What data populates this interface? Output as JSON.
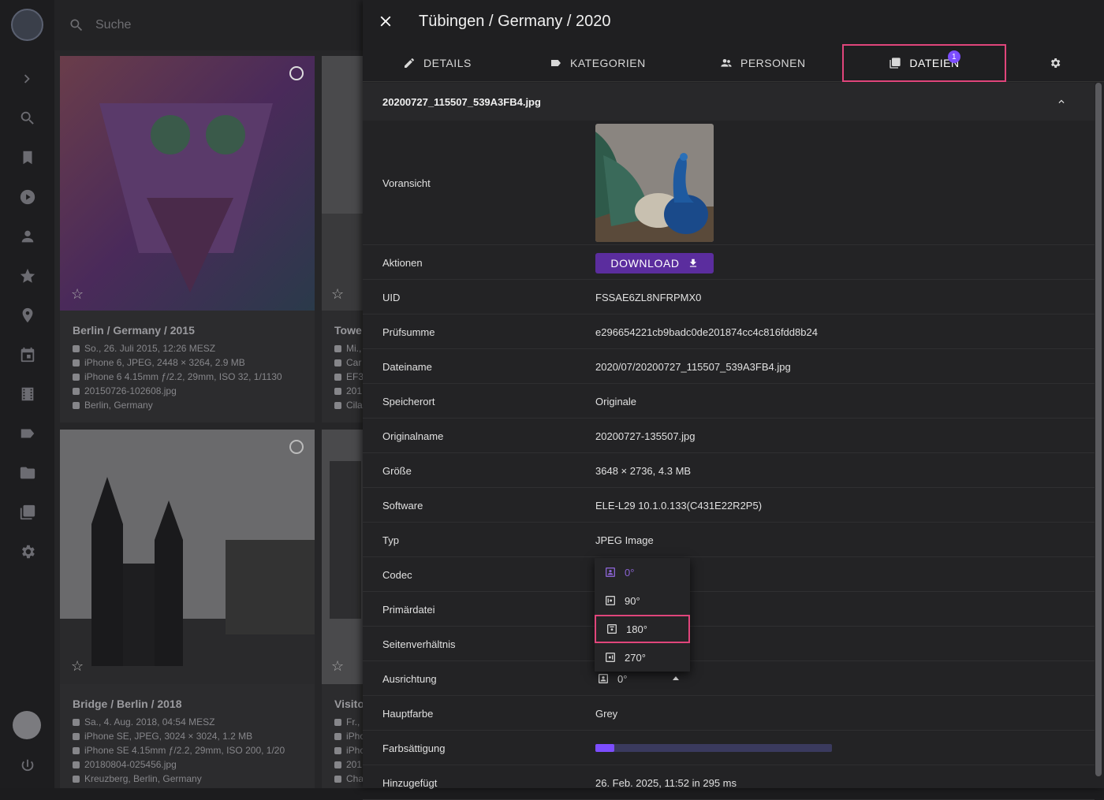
{
  "search": {
    "placeholder": "Suche"
  },
  "nav": {
    "items": [
      "expand-icon",
      "search-icon",
      "bookmark-icon",
      "play-icon",
      "person-icon",
      "star-icon",
      "location-icon",
      "calendar-icon",
      "film-icon",
      "tag-icon",
      "folder-icon",
      "files-icon",
      "gear-icon"
    ],
    "power": "power-icon"
  },
  "cards": [
    {
      "title": "Berlin / Germany / 2015",
      "lines": [
        "So., 26. Juli 2015, 12:26 MESZ",
        "iPhone 6, JPEG, 2448 × 3264, 2.9 MB",
        "iPhone 6 4.15mm ƒ/2.2, 29mm, ISO 32, 1/1130",
        "20150726-102608.jpg",
        "Berlin, Germany"
      ]
    },
    {
      "title": "Towe",
      "lines": [
        "Mi.,",
        "Car",
        "EF3",
        "201",
        "Cila"
      ]
    },
    {
      "title": "Bridge / Berlin / 2018",
      "lines": [
        "Sa., 4. Aug. 2018, 04:54 MESZ",
        "iPhone SE, JPEG, 3024 × 3024, 1.2 MB",
        "iPhone SE 4.15mm ƒ/2.2, 29mm, ISO 200, 1/20",
        "20180804-025456.jpg",
        "Kreuzberg, Berlin, Germany"
      ]
    },
    {
      "title": "Visito",
      "lines": [
        "Fr.,",
        "iPho",
        "iPho",
        "201",
        "Cha"
      ]
    }
  ],
  "panel": {
    "title": "Tübingen / Germany / 2020",
    "tabs": [
      {
        "label": "DETAILS",
        "icon": "pencil-icon"
      },
      {
        "label": "KATEGORIEN",
        "icon": "label-icon"
      },
      {
        "label": "PERSONEN",
        "icon": "people-icon"
      },
      {
        "label": "DATEIEN",
        "icon": "files-icon",
        "badge": "1"
      }
    ],
    "file": {
      "name": "20200727_115507_539A3FB4.jpg"
    },
    "labels": {
      "preview": "Voransicht",
      "actions": "Aktionen",
      "download": "DOWNLOAD"
    },
    "rows": [
      {
        "label": "UID",
        "value": "FSSAE6ZL8NFRPMX0"
      },
      {
        "label": "Prüfsumme",
        "value": "e296654221cb9badc0de201874cc4c816fdd8b24"
      },
      {
        "label": "Dateiname",
        "value": "2020/07/20200727_115507_539A3FB4.jpg"
      },
      {
        "label": "Speicherort",
        "value": "Originale"
      },
      {
        "label": "Originalname",
        "value": "20200727-135507.jpg"
      },
      {
        "label": "Größe",
        "value": "3648 × 2736, 4.3 MB"
      },
      {
        "label": "Software",
        "value": "ELE-L29 10.1.0.133(C431E22R2P5)"
      },
      {
        "label": "Typ",
        "value": "JPEG Image"
      },
      {
        "label": "Codec",
        "value": ""
      },
      {
        "label": "Primärdatei",
        "value": ""
      },
      {
        "label": "Seitenverhältnis",
        "value": ""
      },
      {
        "label": "Ausrichtung",
        "value": "0°"
      },
      {
        "label": "Hauptfarbe",
        "value": "Grey"
      },
      {
        "label": "Farbsättigung",
        "value": ""
      },
      {
        "label": "Hinzugefügt",
        "value": "26. Feb. 2025, 11:52 in 295 ms"
      }
    ],
    "rotation_menu": [
      {
        "label": "0°",
        "selected": true
      },
      {
        "label": "90°"
      },
      {
        "label": "180°",
        "highlighted": true
      },
      {
        "label": "270°"
      }
    ],
    "saturation": 0.08
  },
  "colors": {
    "accent": "#7c4dff",
    "highlight": "#e0457b",
    "download": "#5b2d9e"
  }
}
